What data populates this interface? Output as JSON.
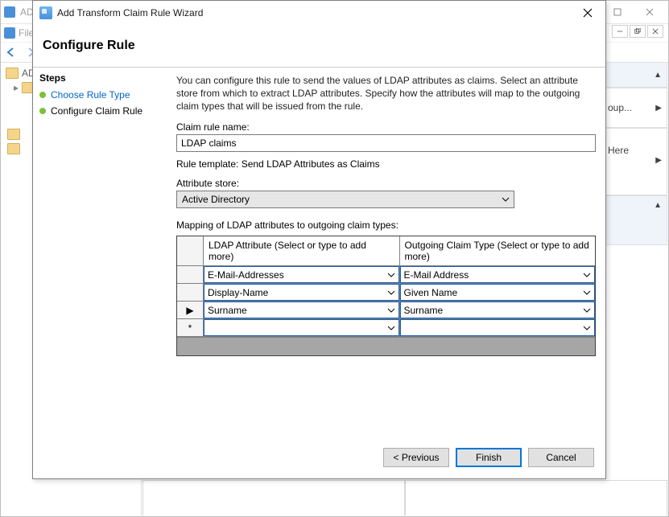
{
  "background": {
    "title": "AD FS",
    "menu_file": "File",
    "sidebar_root": "AD",
    "right_panel": {
      "row1_suffix": "oup...",
      "row2": "Here"
    }
  },
  "dialog": {
    "title": "Add Transform Claim Rule Wizard",
    "header": "Configure Rule",
    "steps_label": "Steps",
    "steps": [
      {
        "label": "Choose Rule Type",
        "is_link": true
      },
      {
        "label": "Configure Claim Rule",
        "is_link": false
      }
    ],
    "description": "You can configure this rule to send the values of LDAP attributes as claims. Select an attribute store from which to extract LDAP attributes. Specify how the attributes will map to the outgoing claim types that will be issued from the rule.",
    "rule_name_label": "Claim rule name:",
    "rule_name_value": "LDAP claims",
    "rule_template_label": "Rule template: Send LDAP Attributes as Claims",
    "attribute_store_label": "Attribute store:",
    "attribute_store_value": "Active Directory",
    "mapping_label": "Mapping of LDAP attributes to outgoing claim types:",
    "mapping_headers": {
      "ldap": "LDAP Attribute (Select or type to add more)",
      "claim": "Outgoing Claim Type (Select or type to add more)"
    },
    "mapping_rows": [
      {
        "indicator": "",
        "ldap": "E-Mail-Addresses",
        "claim": "E-Mail Address"
      },
      {
        "indicator": "",
        "ldap": "Display-Name",
        "claim": "Given Name"
      },
      {
        "indicator": "▶",
        "ldap": "Surname",
        "claim": "Surname"
      },
      {
        "indicator": "*",
        "ldap": "",
        "claim": ""
      }
    ],
    "buttons": {
      "previous": "< Previous",
      "finish": "Finish",
      "cancel": "Cancel"
    }
  }
}
